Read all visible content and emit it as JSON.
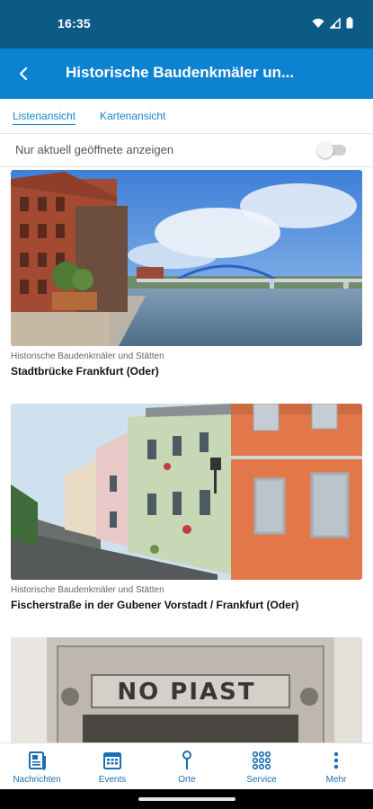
{
  "status_bar": {
    "time": "16:35"
  },
  "app_bar": {
    "title": "Historische Baudenkmäler un..."
  },
  "tabs": [
    {
      "label": "Listenansicht",
      "active": true
    },
    {
      "label": "Kartenansicht",
      "active": false
    }
  ],
  "filter": {
    "label": "Nur aktuell geöffnete anzeigen",
    "enabled": false
  },
  "items": [
    {
      "category": "Historische Baudenkmäler und Stätten",
      "title": "Stadtbrücke Frankfurt (Oder)"
    },
    {
      "category": "Historische Baudenkmäler und Stätten",
      "title": "Fischerstraße in der Gubener Vorstadt / Frankfurt (Oder)"
    },
    {
      "category": "",
      "title": "",
      "sign_text": "NO PIAST"
    }
  ],
  "bottom_nav": [
    {
      "label": "Nachrichten",
      "icon": "newspaper-icon"
    },
    {
      "label": "Events",
      "icon": "calendar-icon"
    },
    {
      "label": "Orte",
      "icon": "pin-icon"
    },
    {
      "label": "Service",
      "icon": "grid-icon"
    },
    {
      "label": "Mehr",
      "icon": "more-vertical-icon"
    }
  ],
  "colors": {
    "status_bar": "#0c5a86",
    "app_bar": "#0d82d0",
    "accent": "#1a86cf"
  }
}
